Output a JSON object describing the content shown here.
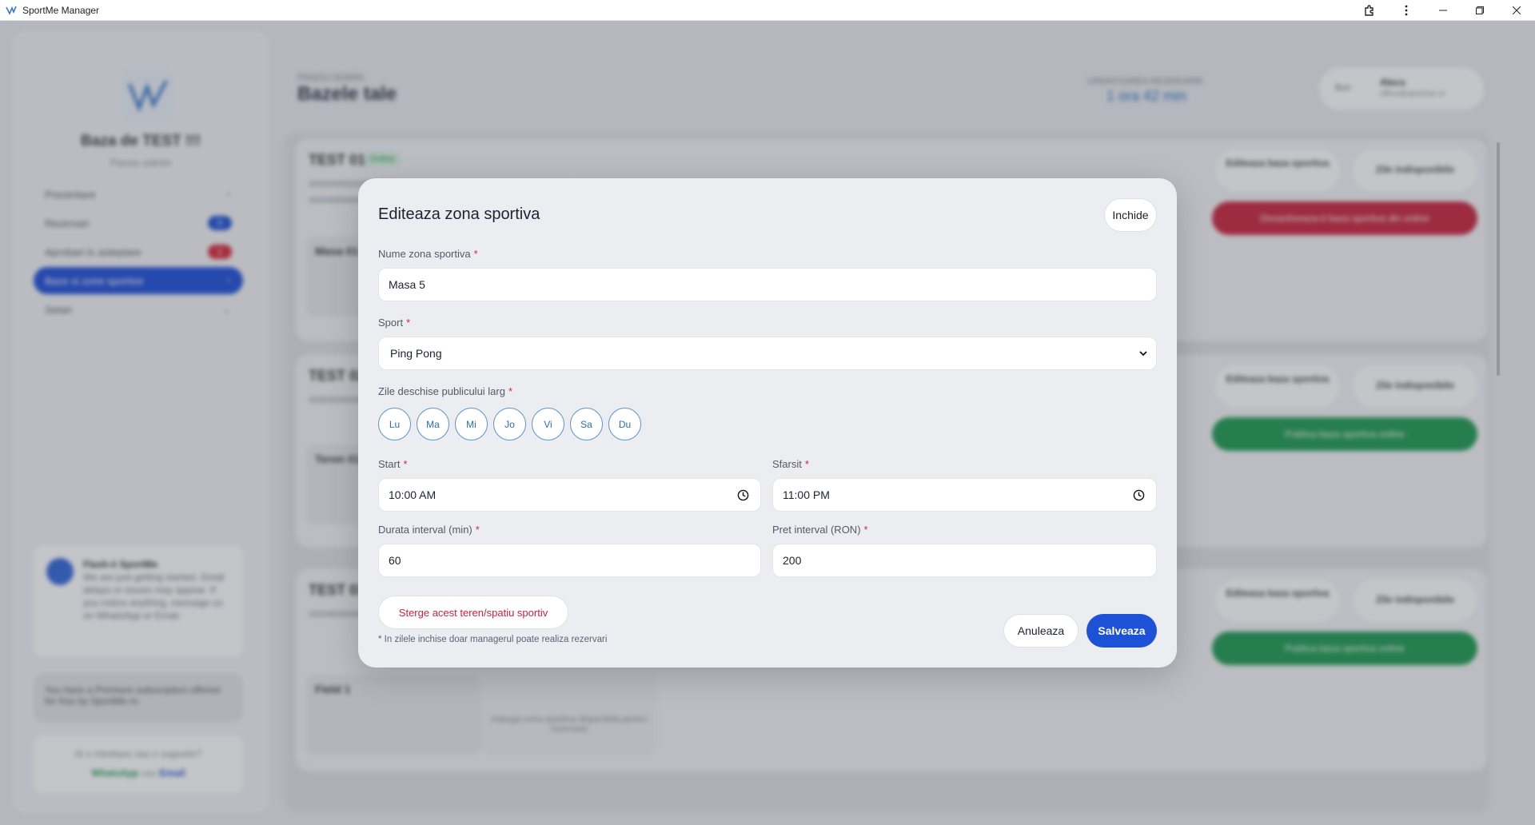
{
  "window": {
    "title": "SportMe Manager",
    "icons": [
      "extensions-icon",
      "more-vertical-icon",
      "minimize-icon",
      "maximize-icon",
      "close-icon"
    ]
  },
  "sidebar": {
    "base_name": "Baza de TEST !!!",
    "subtitle": "Panou admin",
    "items": [
      {
        "label": "Prezentare"
      },
      {
        "label": "Rezervari",
        "badge": "0"
      },
      {
        "label": "Aprobari in asteptare",
        "badge": "1"
      },
      {
        "label": "Baze si zone sportive"
      },
      {
        "label": "Setari"
      }
    ],
    "chat": {
      "title": "Flash-ii SportMe",
      "text": "We are just getting started. Small delays or issues may appear. If you notice anything, message us on WhatsApp or Email."
    },
    "premium": "You have a Premium subscription offered for free by SportMe.ro",
    "contact": {
      "question": "Ai o intrebare sau o sugestie?",
      "whatsapp": "WhatsApp",
      "or": "sau",
      "email": "Email"
    }
  },
  "header": {
    "subtitle": "PANOU ADMIN",
    "title": "Bazele tale",
    "next_label": "URMATOAREA REZERVARE",
    "next_value": "1 ora 42 min",
    "user_label": "Bun",
    "user_name": "Alecs",
    "user_email": "office@sportme.ro"
  },
  "bases": [
    {
      "title": "TEST 01",
      "status": "Online",
      "field": "Masa 01",
      "action": "Dezactiveaza-ti baza sportiva din online"
    },
    {
      "title": "TEST 02",
      "field": "Teren 01",
      "action": "Publica baza sportiva online"
    },
    {
      "title": "TEST 03",
      "field": "Field 1",
      "action": "Publica baza sportiva online"
    }
  ],
  "base_buttons": {
    "edit": "Editeaza baza sportiva",
    "unavailable": "Zile indisponibile",
    "add_zone": "Adauga zona sportiva disponibila pentru rezervare"
  },
  "colors": {
    "accent": "#1d52d6",
    "danger": "#c8243e",
    "day_border": "#5b96c8",
    "success": "#1d9a52"
  },
  "modal": {
    "title": "Editeaza zona sportiva",
    "close_label": "Inchide",
    "name_label": "Nume zona sportiva",
    "name_value": "Masa 5",
    "sport_label": "Sport",
    "sport_value": "Ping Pong",
    "days_label": "Zile deschise publicului larg",
    "days": [
      "Lu",
      "Ma",
      "Mi",
      "Jo",
      "Vi",
      "Sa",
      "Du"
    ],
    "start_label": "Start",
    "start_value": "10:00 AM",
    "end_label": "Sfarsit",
    "end_value": "11:00 PM",
    "duration_label": "Durata interval (min)",
    "duration_value": "60",
    "price_label": "Pret interval (RON)",
    "price_value": "200",
    "delete_label": "Sterge acest teren/spatiu sportiv",
    "note": "* In zilele inchise doar managerul poate realiza rezervari",
    "cancel_label": "Anuleaza",
    "save_label": "Salveaza",
    "required_mark": "*"
  }
}
